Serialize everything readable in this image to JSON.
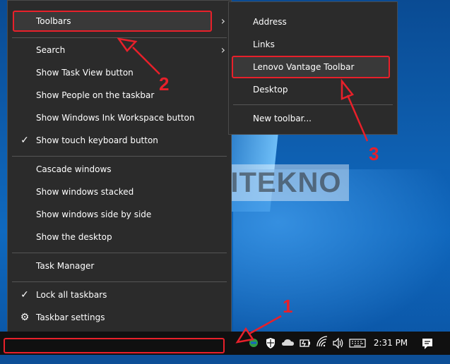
{
  "context_menu": {
    "items": [
      {
        "label": "Toolbars",
        "has_submenu": true
      },
      {
        "label": "Search",
        "has_submenu": true
      },
      {
        "label": "Show Task View button"
      },
      {
        "label": "Show People on the taskbar"
      },
      {
        "label": "Show Windows Ink Workspace button"
      },
      {
        "label": "Show touch keyboard button",
        "checked": true
      },
      {
        "label": "Cascade windows"
      },
      {
        "label": "Show windows stacked"
      },
      {
        "label": "Show windows side by side"
      },
      {
        "label": "Show the desktop"
      },
      {
        "label": "Task Manager"
      },
      {
        "label": "Lock all taskbars",
        "checked": true
      },
      {
        "label": "Taskbar settings",
        "icon": "gear-icon"
      }
    ]
  },
  "toolbars_submenu": {
    "items": [
      {
        "label": "Address"
      },
      {
        "label": "Links"
      },
      {
        "label": "Lenovo Vantage Toolbar"
      },
      {
        "label": "Desktop"
      },
      {
        "label": "New toolbar..."
      }
    ]
  },
  "watermark": "BAGITEKNO",
  "annotations": [
    "1",
    "2",
    "3"
  ],
  "taskbar": {
    "clock": "2:31 PM",
    "tray_icons": [
      "lenovo-vantage-icon",
      "security-shield-icon",
      "onedrive-cloud-icon",
      "battery-icon",
      "wifi-icon",
      "volume-icon",
      "keyboard-icon",
      "notification-icon"
    ]
  },
  "colors": {
    "menu_bg": "#2b2b2b",
    "highlight_red": "#e8202a",
    "taskbar_bg": "#101010"
  }
}
